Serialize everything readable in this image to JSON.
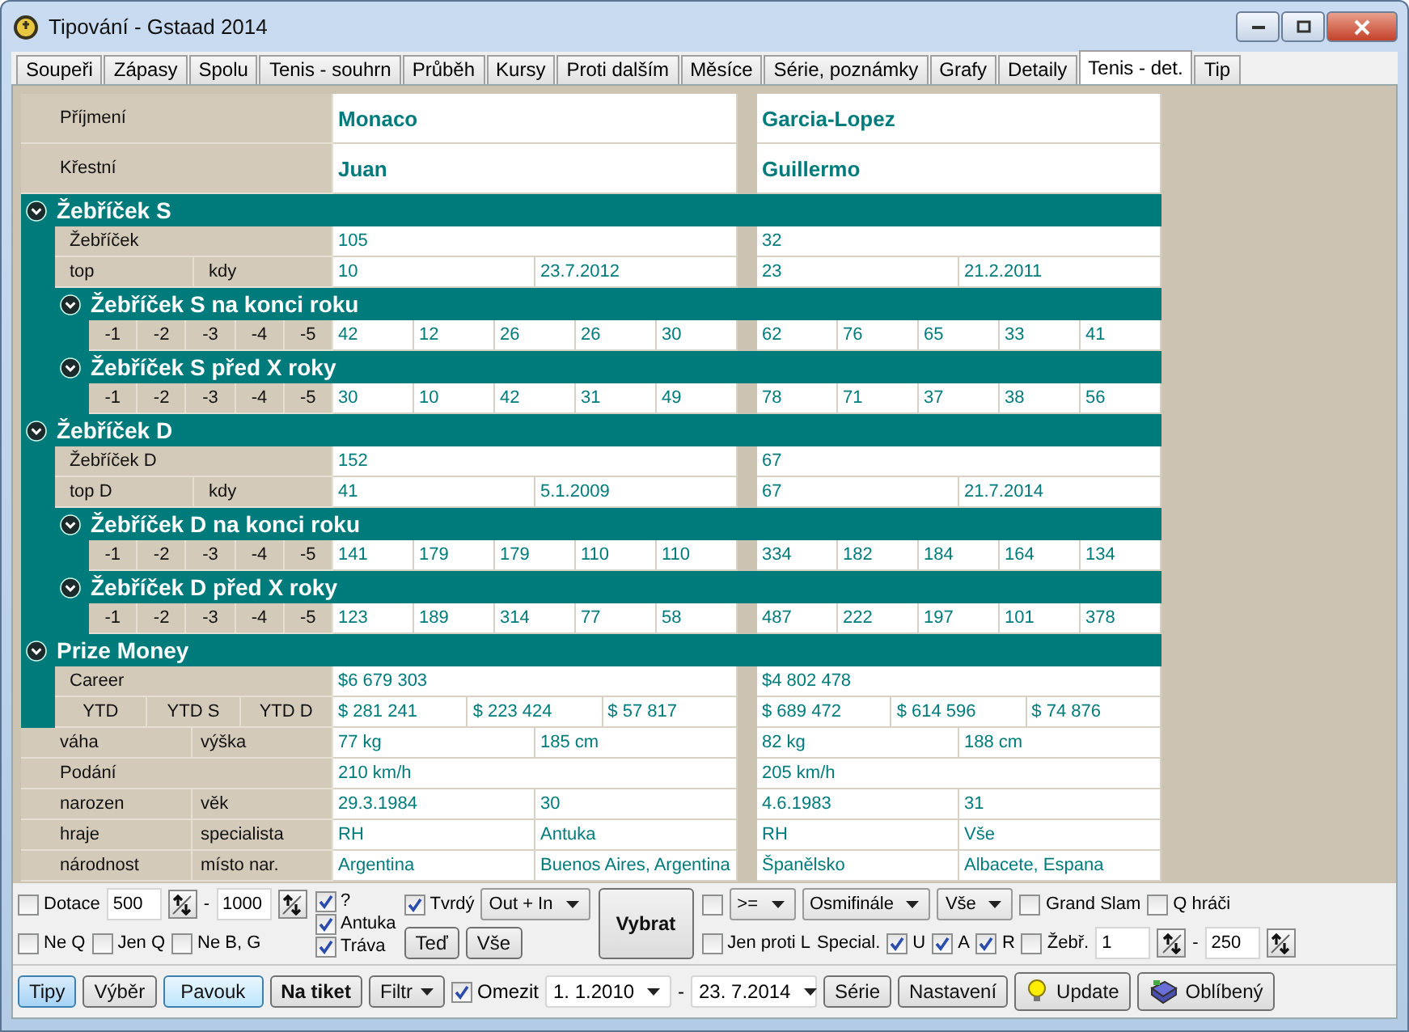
{
  "window": {
    "title": "Tipování - Gstaad 2014"
  },
  "tabs": [
    {
      "label": "Soupeři",
      "selected": false
    },
    {
      "label": "Zápasy",
      "selected": false
    },
    {
      "label": "Spolu",
      "selected": false
    },
    {
      "label": "Tenis - souhrn",
      "selected": false
    },
    {
      "label": "Průběh",
      "selected": false
    },
    {
      "label": "Kursy",
      "selected": false
    },
    {
      "label": "Proti dalším",
      "selected": false
    },
    {
      "label": "Měsíce",
      "selected": false
    },
    {
      "label": "Série, poznámky",
      "selected": false
    },
    {
      "label": "Grafy",
      "selected": false
    },
    {
      "label": "Detaily",
      "selected": false
    },
    {
      "label": "Tenis - det.",
      "selected": true
    },
    {
      "label": "Tip",
      "selected": false
    }
  ],
  "detail": [
    {
      "kind": "name",
      "labels": [
        "Příjmení"
      ],
      "players": [
        [
          "Monaco"
        ],
        [
          "Garcia-Lopez"
        ]
      ]
    },
    {
      "kind": "name",
      "labels": [
        "Křestní"
      ],
      "players": [
        [
          "Juan"
        ],
        [
          "Guillermo"
        ]
      ]
    },
    {
      "kind": "section",
      "title": "Žebříček S",
      "expanded": true,
      "children": [
        {
          "kind": "row",
          "labels": [
            "Žebříček"
          ],
          "players": [
            [
              "105"
            ],
            [
              "32"
            ]
          ]
        },
        {
          "kind": "row",
          "labels": [
            "top",
            "kdy"
          ],
          "players": [
            [
              "10",
              "23.7.2012"
            ],
            [
              "23",
              "21.2.2011"
            ]
          ]
        },
        {
          "kind": "section",
          "title": "Žebříček S na konci roku",
          "expanded": true,
          "children": [
            {
              "kind": "row",
              "labels": [
                "-1",
                "-2",
                "-3",
                "-4",
                "-5"
              ],
              "players": [
                [
                  "42",
                  "12",
                  "26",
                  "26",
                  "30"
                ],
                [
                  "62",
                  "76",
                  "65",
                  "33",
                  "41"
                ]
              ]
            }
          ]
        },
        {
          "kind": "section",
          "title": "Žebříček S před X roky",
          "expanded": true,
          "children": [
            {
              "kind": "row",
              "labels": [
                "-1",
                "-2",
                "-3",
                "-4",
                "-5"
              ],
              "players": [
                [
                  "30",
                  "10",
                  "42",
                  "31",
                  "49"
                ],
                [
                  "78",
                  "71",
                  "37",
                  "38",
                  "56"
                ]
              ]
            }
          ]
        }
      ]
    },
    {
      "kind": "section",
      "title": "Žebříček D",
      "expanded": true,
      "children": [
        {
          "kind": "row",
          "labels": [
            "Žebříček D"
          ],
          "players": [
            [
              "152"
            ],
            [
              "67"
            ]
          ]
        },
        {
          "kind": "row",
          "labels": [
            "top D",
            "kdy"
          ],
          "players": [
            [
              "41",
              "5.1.2009"
            ],
            [
              "67",
              "21.7.2014"
            ]
          ]
        },
        {
          "kind": "section",
          "title": "Žebříček D na konci roku",
          "expanded": true,
          "children": [
            {
              "kind": "row",
              "labels": [
                "-1",
                "-2",
                "-3",
                "-4",
                "-5"
              ],
              "players": [
                [
                  "141",
                  "179",
                  "179",
                  "110",
                  "110"
                ],
                [
                  "334",
                  "182",
                  "184",
                  "164",
                  "134"
                ]
              ]
            }
          ]
        },
        {
          "kind": "section",
          "title": "Žebříček D před X roky",
          "expanded": true,
          "children": [
            {
              "kind": "row",
              "labels": [
                "-1",
                "-2",
                "-3",
                "-4",
                "-5"
              ],
              "players": [
                [
                  "123",
                  "189",
                  "314",
                  "77",
                  "58"
                ],
                [
                  "487",
                  "222",
                  "197",
                  "101",
                  "378"
                ]
              ]
            }
          ]
        }
      ]
    },
    {
      "kind": "section",
      "title": "Prize Money",
      "expanded": true,
      "children": [
        {
          "kind": "row",
          "labels": [
            "Career"
          ],
          "players": [
            [
              "$6 679 303"
            ],
            [
              "$4 802 478"
            ]
          ]
        },
        {
          "kind": "row",
          "labels": [
            "YTD",
            "YTD S",
            "YTD D"
          ],
          "players": [
            [
              "$ 281 241",
              "$ 223 424",
              "$ 57 817"
            ],
            [
              "$ 689 472",
              "$ 614 596",
              "$ 74 876"
            ]
          ]
        }
      ]
    },
    {
      "kind": "row",
      "labels": [
        "váha",
        "výška"
      ],
      "players": [
        [
          "77 kg",
          "185 cm"
        ],
        [
          "82 kg",
          "188 cm"
        ]
      ]
    },
    {
      "kind": "row",
      "labels": [
        "Podání"
      ],
      "players": [
        [
          "210 km/h"
        ],
        [
          "205 km/h"
        ]
      ]
    },
    {
      "kind": "row",
      "labels": [
        "narozen",
        "věk"
      ],
      "players": [
        [
          "29.3.1984",
          "30"
        ],
        [
          "4.6.1983",
          "31"
        ]
      ]
    },
    {
      "kind": "row",
      "labels": [
        "hraje",
        "specialista"
      ],
      "players": [
        [
          "RH",
          "Antuka"
        ],
        [
          "RH",
          "Vše"
        ]
      ]
    },
    {
      "kind": "row",
      "labels": [
        "národnost",
        "místo nar."
      ],
      "players": [
        [
          "Argentina",
          "Buenos Aires, Argentina"
        ],
        [
          "Španělsko",
          "Albacete, Espana"
        ]
      ]
    }
  ],
  "filters": [
    {
      "lines": [
        {
          "items": [
            {
              "kind": "checkbox",
              "label": "Dotace",
              "checked": false
            },
            {
              "kind": "field",
              "value": "500"
            },
            {
              "kind": "spinner"
            },
            {
              "kind": "text",
              "text": "-"
            },
            {
              "kind": "field",
              "value": "1000"
            },
            {
              "kind": "spinner"
            }
          ]
        },
        {
          "items": [
            {
              "kind": "checkbox",
              "label": "Ne Q",
              "checked": false
            },
            {
              "kind": "checkbox",
              "label": "Jen Q",
              "checked": false
            },
            {
              "kind": "checkbox",
              "label": "Ne B, G",
              "checked": false
            }
          ]
        }
      ]
    },
    {
      "lines": [
        {
          "items": [
            {
              "kind": "checkbox",
              "label": "?",
              "checked": true
            }
          ]
        },
        {
          "items": [
            {
              "kind": "checkbox",
              "label": "Antuka",
              "checked": true
            }
          ]
        },
        {
          "items": [
            {
              "kind": "checkbox",
              "label": "Tráva",
              "checked": true
            }
          ]
        }
      ]
    },
    {
      "lines": [
        {
          "items": [
            {
              "kind": "checkbox",
              "label": "Tvrdý",
              "checked": true
            },
            {
              "kind": "combo",
              "value": "Out + In"
            }
          ]
        },
        {
          "items": [
            {
              "kind": "button",
              "label": "Teď"
            },
            {
              "kind": "button",
              "label": "Vše"
            }
          ]
        }
      ]
    },
    {
      "lines": [
        {
          "items": [
            {
              "kind": "primary",
              "label": "Vybrat"
            }
          ]
        }
      ]
    },
    {
      "lines": [
        {
          "items": [
            {
              "kind": "checkbox",
              "checked": false
            },
            {
              "kind": "combo",
              "value": ">="
            },
            {
              "kind": "combo",
              "value": "Osmifinále"
            },
            {
              "kind": "combo",
              "value": "Vše"
            },
            {
              "kind": "checkbox",
              "label": "Grand Slam",
              "checked": false
            },
            {
              "kind": "checkbox",
              "label": "Q hráči",
              "checked": false
            }
          ]
        },
        {
          "items": [
            {
              "kind": "checkbox",
              "label": "Jen proti L",
              "checked": false
            },
            {
              "kind": "text",
              "text": "Special."
            },
            {
              "kind": "checkbox",
              "label": "U",
              "checked": true
            },
            {
              "kind": "checkbox",
              "label": "A",
              "checked": true
            },
            {
              "kind": "checkbox",
              "label": "R",
              "checked": true
            },
            {
              "kind": "checkbox",
              "label": "Žebř.",
              "checked": false
            },
            {
              "kind": "field",
              "value": "1"
            },
            {
              "kind": "spinner"
            },
            {
              "kind": "text",
              "text": "-"
            },
            {
              "kind": "field",
              "value": "250"
            },
            {
              "kind": "spinner"
            }
          ]
        }
      ]
    }
  ],
  "toolbar": [
    {
      "kind": "toggle",
      "label": "Tipy",
      "selected": true
    },
    {
      "kind": "toggle",
      "label": "Výběr",
      "selected": false
    },
    {
      "kind": "default",
      "label": "Pavouk"
    },
    {
      "kind": "primary",
      "label": "Na tiket"
    },
    {
      "kind": "menu",
      "label": "Filtr"
    },
    {
      "kind": "checkbox",
      "label": "Omezit",
      "checked": true
    },
    {
      "kind": "date",
      "value": "1. 1.2010"
    },
    {
      "kind": "text",
      "text": "-"
    },
    {
      "kind": "date",
      "value": "23. 7.2014"
    },
    {
      "kind": "button",
      "label": "Série"
    },
    {
      "kind": "button",
      "label": "Nastavení"
    },
    {
      "kind": "bulbbutton",
      "label": "Update"
    },
    {
      "kind": "bookbutton",
      "label": "Oblíbený"
    }
  ]
}
